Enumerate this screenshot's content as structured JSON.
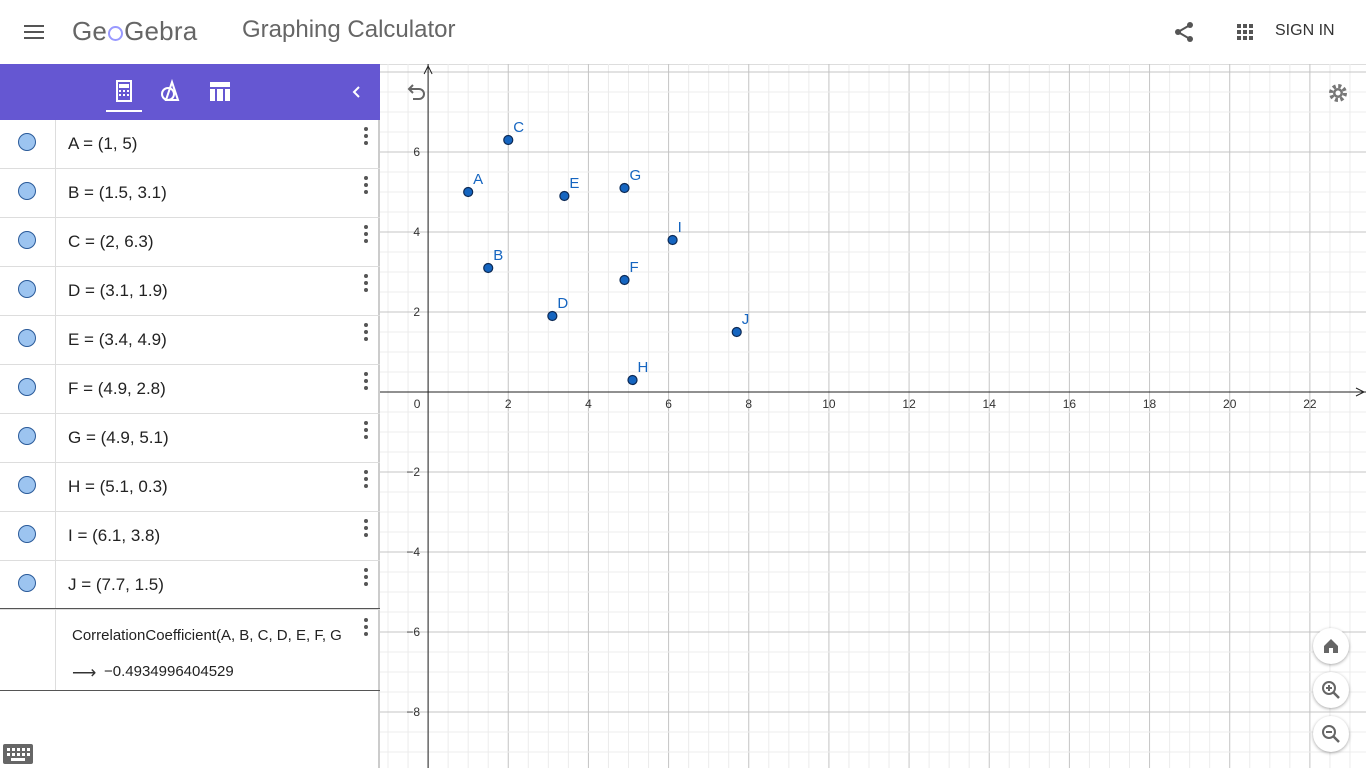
{
  "app": {
    "logo_text": "GeoGebra",
    "title": "Graphing Calculator",
    "signin_label": "SIGN IN"
  },
  "algebra": {
    "rows": [
      {
        "expr": "A = (1, 5)"
      },
      {
        "expr": "B = (1.5, 3.1)"
      },
      {
        "expr": "C = (2, 6.3)"
      },
      {
        "expr": "D = (3.1, 1.9)"
      },
      {
        "expr": "E = (3.4, 4.9)"
      },
      {
        "expr": "F = (4.9, 2.8)"
      },
      {
        "expr": "G = (4.9, 5.1)"
      },
      {
        "expr": "H = (5.1, 0.3)"
      },
      {
        "expr": "I = (6.1, 3.8)"
      },
      {
        "expr": "J = (7.7, 1.5)"
      }
    ],
    "command": "CorrelationCoefficient(A, B, C, D, E, F, G",
    "arrow": "⟶",
    "result": "−0.4934996404529"
  },
  "graph": {
    "x_range": [
      -1.2,
      23.4
    ],
    "y_range": [
      -9.4,
      8.2
    ],
    "x_ticks": [
      0,
      2,
      4,
      6,
      8,
      10,
      12,
      14,
      16,
      18,
      20,
      22
    ],
    "y_ticks": [
      -8,
      -6,
      -4,
      -2,
      2,
      4,
      6
    ],
    "points": [
      {
        "name": "A",
        "x": 1,
        "y": 5
      },
      {
        "name": "B",
        "x": 1.5,
        "y": 3.1
      },
      {
        "name": "C",
        "x": 2,
        "y": 6.3
      },
      {
        "name": "D",
        "x": 3.1,
        "y": 1.9
      },
      {
        "name": "E",
        "x": 3.4,
        "y": 4.9
      },
      {
        "name": "F",
        "x": 4.9,
        "y": 2.8
      },
      {
        "name": "G",
        "x": 4.9,
        "y": 5.1
      },
      {
        "name": "H",
        "x": 5.1,
        "y": 0.3
      },
      {
        "name": "I",
        "x": 6.1,
        "y": 3.8
      },
      {
        "name": "J",
        "x": 7.7,
        "y": 1.5
      }
    ],
    "point_color": "#1565c0",
    "accent_color": "#6557d2"
  }
}
